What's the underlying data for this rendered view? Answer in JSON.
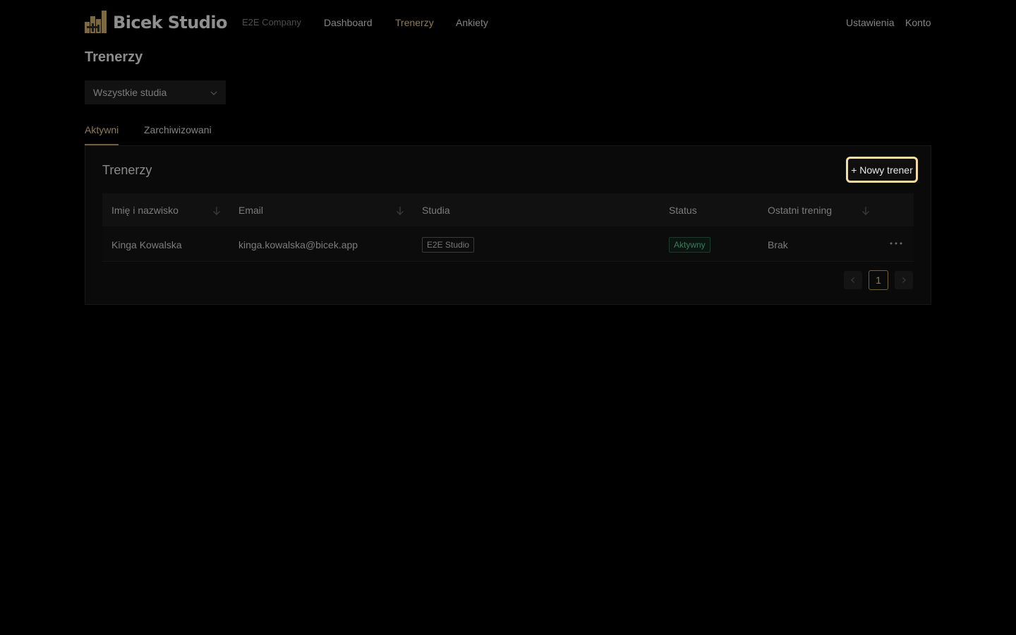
{
  "header": {
    "logo_text": "Bicek Studio",
    "company": "E2E Company",
    "nav": {
      "dashboard": "Dashboard",
      "trainers": "Trenerzy",
      "surveys": "Ankiety"
    },
    "settings": "Ustawienia",
    "account": "Konto"
  },
  "page": {
    "title": "Trenerzy",
    "studio_filter": {
      "selected": "Wszystkie studia"
    }
  },
  "tabs": {
    "active": "Aktywni",
    "archived": "Zarchiwizowani"
  },
  "card": {
    "title": "Trenerzy",
    "new_button": "+ Nowy trener"
  },
  "table": {
    "columns": {
      "name": "Imię i nazwisko",
      "email": "Email",
      "studios": "Studia",
      "status": "Status",
      "last_training": "Ostatni trening"
    },
    "rows": [
      {
        "name": "Kinga Kowalska",
        "email": "kinga.kowalska@bicek.app",
        "studio": "E2E Studio",
        "status": "Aktywny",
        "last_training": "Brak"
      }
    ]
  },
  "pagination": {
    "current_page": "1"
  },
  "colors": {
    "accent": "#8c7b56",
    "button_focus_ring": "#f3dda3",
    "status_active": "#3e7a5b",
    "background": "#000000"
  },
  "icons": {
    "logo": "bicek-studio-logo-icon",
    "select": "chevron-down-icon",
    "sort": "arrow-down-icon",
    "row_menu": "more-horizontal-icon",
    "prev": "chevron-left-icon",
    "next": "chevron-right-icon"
  }
}
